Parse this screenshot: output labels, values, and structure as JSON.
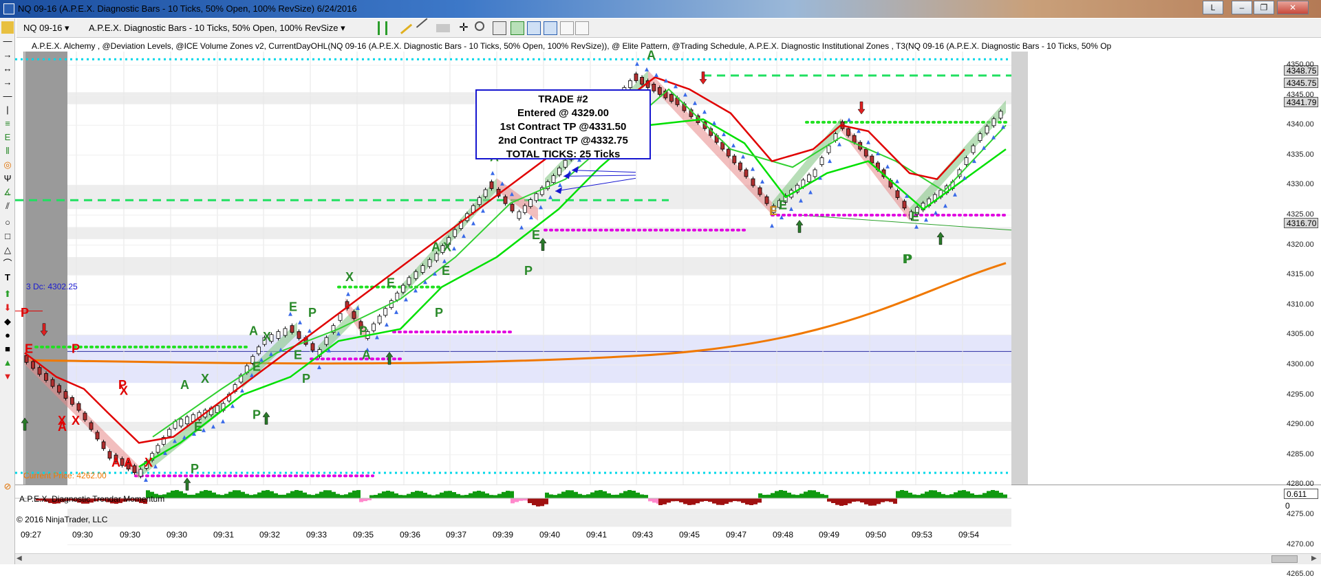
{
  "window": {
    "title": "NQ 09-16 (A.P.E.X. Diagnostic Bars - 10 Ticks, 50% Open, 100% RevSize)  6/24/2016",
    "buttons": [
      "L",
      "–",
      "❐",
      "✕"
    ]
  },
  "toolbar": {
    "instrument": "NQ 09-16",
    "bar_type": "A.P.E.X. Diagnostic Bars - 10 Ticks, 50% Open, 100% RevSize"
  },
  "chart": {
    "indicators_line": "A.P.E.X. Alchemy , @Deviation Levels, @ICE Volume Zones v2, CurrentDayOHL(NQ 09-16 (A.P.E.X. Diagnostic Bars - 10 Ticks, 50% Open, 100% RevSize)), @ Elite Pattern, @Trading Schedule, A.P.E.X. Diagnostic Institutional Zones , T3(NQ 09-16 (A.P.E.X. Diagnostic Bars - 10 Ticks, 50% Op",
    "level_label": "3 Dc: 4302.25",
    "current_price_label": "Current Price: 4262.00",
    "price_axis": [
      "4350.00",
      "4345.00",
      "4340.00",
      "4335.00",
      "4330.00",
      "4325.00",
      "4320.00",
      "4315.00",
      "4310.00",
      "4305.00",
      "4300.00",
      "4295.00",
      "4290.00",
      "4285.00",
      "4280.00",
      "4275.00",
      "4270.00",
      "4265.00"
    ],
    "price_tags": [
      {
        "text": "4348.75",
        "color": "#d9d9d9"
      },
      {
        "text": "4345.75",
        "color": "#d9d9d9"
      },
      {
        "text": "4341.79",
        "color": "#d9d9d9"
      },
      {
        "text": "4316.70",
        "color": "#d9d9d9"
      }
    ],
    "time_axis": [
      "09:27",
      "09:30",
      "09:30",
      "09:30",
      "09:31",
      "09:32",
      "09:33",
      "09:35",
      "09:36",
      "09:37",
      "09:39",
      "09:40",
      "09:41",
      "09:43",
      "09:45",
      "09:47",
      "09:48",
      "09:49",
      "09:50",
      "09:53",
      "09:54"
    ],
    "trade_box": {
      "line1": "TRADE #2",
      "line2": "Entered @ 4329.00",
      "line3": "1st Contract TP @4331.50",
      "line4": "2nd Contract TP @4332.75",
      "line5": "TOTAL TICKS: 25 Ticks"
    },
    "signal_letters": [
      "P",
      "E",
      "P",
      "P",
      "X",
      "A",
      "A",
      "X",
      "A",
      "X",
      "X",
      "P",
      "E",
      "P",
      "A",
      "X",
      "E",
      "A",
      "X",
      "E",
      "P",
      "E",
      "P",
      "A",
      "X",
      "E",
      "P",
      "A",
      "X",
      "E",
      "P",
      "A",
      "X",
      "E",
      "P",
      "A",
      "E",
      "P",
      "E",
      "P",
      "E"
    ]
  },
  "sub_panel": {
    "title": "A.P.E.X. Diagnostic Trendar Momentum",
    "copyright": "© 2016 NinjaTrader, LLC",
    "axis_tag": "0.611",
    "zero_label": "0"
  },
  "colors": {
    "trend_green": "#00e000",
    "trend_red": "#e00000",
    "cyan_level": "#00d8e8",
    "magenta_level": "#e000e0",
    "orange_ma": "#f07800",
    "blue_box": "#1515d0"
  }
}
